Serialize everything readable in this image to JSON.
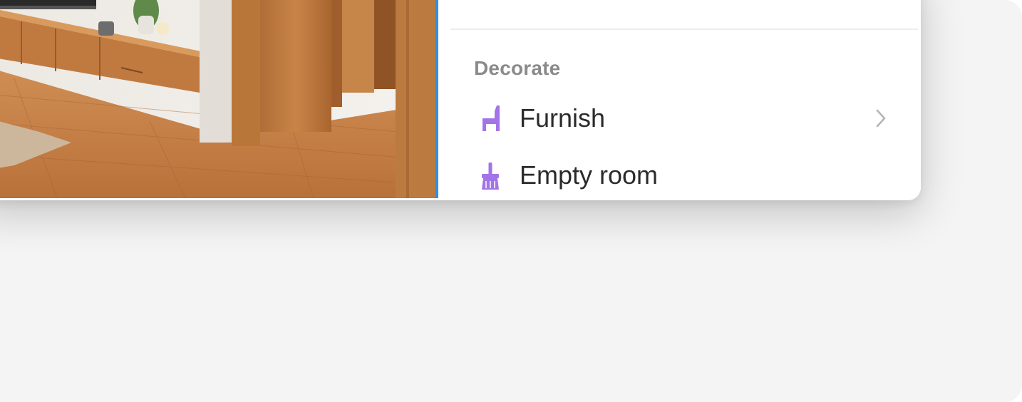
{
  "panel": {
    "section_title": "Decorate",
    "items": [
      {
        "label": "Furnish",
        "icon": "chair-icon",
        "has_submenu": true
      },
      {
        "label": "Empty room",
        "icon": "broom-icon",
        "has_submenu": false
      }
    ]
  },
  "colors": {
    "accent_icon": "#a374e8",
    "selection_edge": "#2f8fe8",
    "section_title": "#8a8a8a",
    "label_text": "#2b2b2b"
  }
}
